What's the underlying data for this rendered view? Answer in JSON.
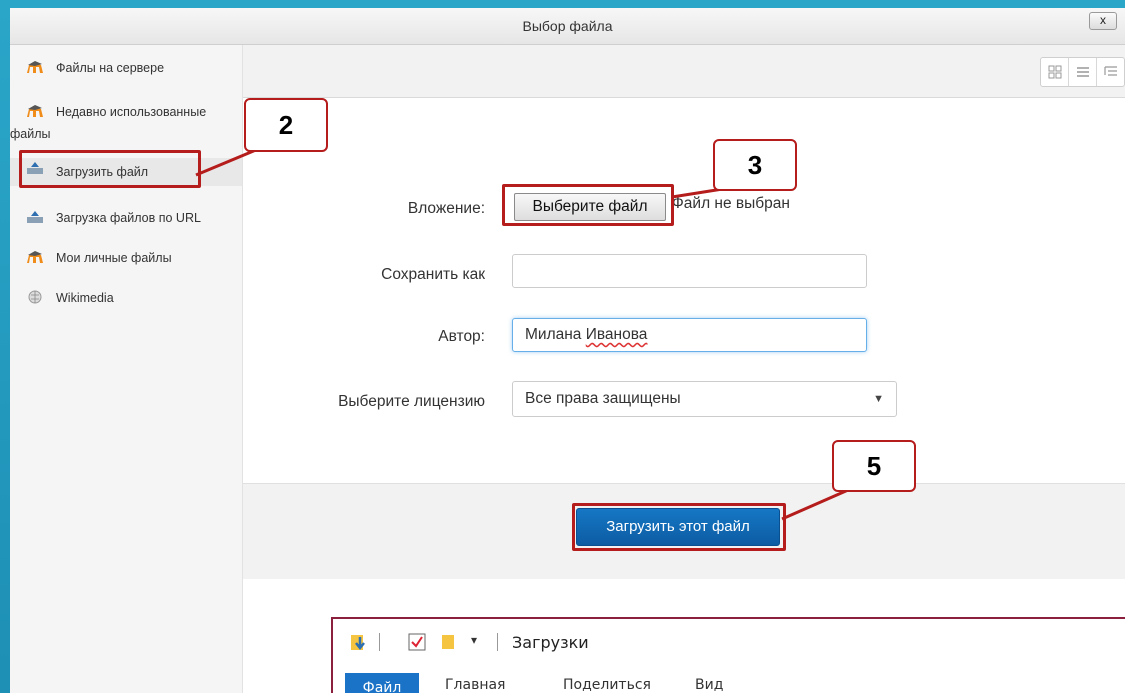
{
  "dialog": {
    "title": "Выбор файла",
    "close_label": "x"
  },
  "sidebar": {
    "items": [
      {
        "label": "Файлы на сервере",
        "icon": "moodle-icon"
      },
      {
        "label": "Недавно использованные",
        "label_cont": "файлы",
        "icon": "moodle-icon"
      },
      {
        "label": "Загрузить файл",
        "icon": "upload-icon",
        "active": true
      },
      {
        "label": "Загрузка файлов по URL",
        "icon": "url-download-icon"
      },
      {
        "label": "Мои личные файлы",
        "icon": "moodle-icon"
      },
      {
        "label": "Wikimedia",
        "icon": "wikimedia-icon"
      }
    ]
  },
  "form": {
    "attachment_label": "Вложение:",
    "choose_file_label": "Выберите файл",
    "file_status": "Файл не выбран",
    "save_as_label": "Сохранить как",
    "save_as_value": "",
    "author_label": "Автор:",
    "author_first": "Милана",
    "author_last": "Иванова",
    "license_label": "Выберите лицензию",
    "license_value": "Все права защищены"
  },
  "footer": {
    "upload_label": "Загрузить этот файл"
  },
  "callouts": {
    "c2": "2",
    "c3": "3",
    "c5": "5"
  },
  "explorer": {
    "title": "Загрузки",
    "tabs": [
      "Файл",
      "Главная",
      "Поделиться",
      "Вид"
    ]
  },
  "colors": {
    "accent": "#b51c1c",
    "primary": "#0c5ca3",
    "background": "#1e8fb5"
  }
}
